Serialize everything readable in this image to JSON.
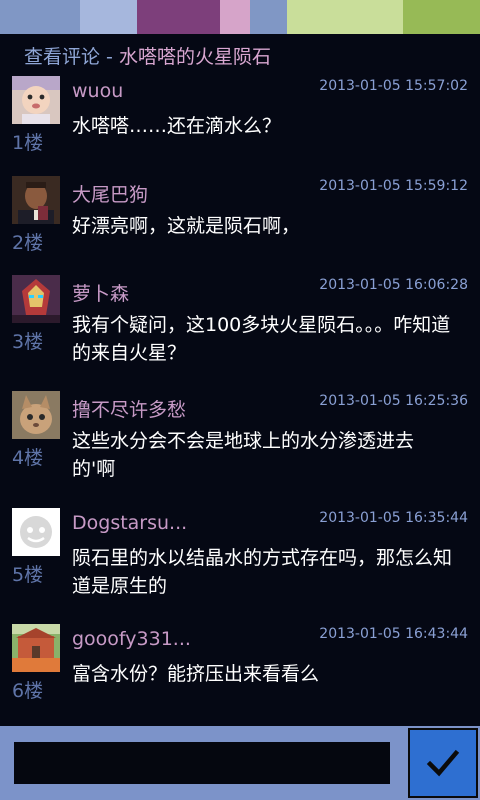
{
  "topbar": {
    "colors": [
      "#8097c5",
      "#a6b7dd",
      "#7d3f7b",
      "#d6a4c9",
      "#8097c5",
      "#c9de9a",
      "#97ba56"
    ]
  },
  "header": {
    "prefix": "查看评论 - ",
    "title": "水嗒嗒的火星陨石"
  },
  "comments": [
    {
      "floor": "1楼",
      "user": "wuou",
      "time": "2013-01-05 15:57:02",
      "text": "水嗒嗒……还在滴水么？",
      "avatar": "baby-photo"
    },
    {
      "floor": "2楼",
      "user": "大尾巴狗",
      "time": "2013-01-05 15:59:12",
      "text": "好漂亮啊，这就是陨石啊，",
      "avatar": "man-photo"
    },
    {
      "floor": "3楼",
      "user": "萝卜森",
      "time": "2013-01-05 16:06:28",
      "text": "我有个疑问，这100多块火星陨石。。。咋知道的来自火星？",
      "avatar": "robot-photo"
    },
    {
      "floor": "4楼",
      "user": "撸不尽许多愁",
      "time": "2013-01-05 16:25:36",
      "text": "这些水分会不会是地球上的水分渗透进去的'啊",
      "avatar": "cat-photo"
    },
    {
      "floor": "5楼",
      "user": "Dogstarsu...",
      "time": "2013-01-05 16:35:44",
      "text": "陨石里的水以结晶水的方式存在吗，那怎么知道是原生的",
      "avatar": "default-avatar"
    },
    {
      "floor": "6楼",
      "user": "gooofy331...",
      "time": "2013-01-05 16:43:44",
      "text": "富含水份？能挤压出来看看么",
      "avatar": "cartoon-photo"
    }
  ],
  "input": {
    "value": "",
    "placeholder": ""
  },
  "send": {
    "icon": "checkmark-icon"
  }
}
